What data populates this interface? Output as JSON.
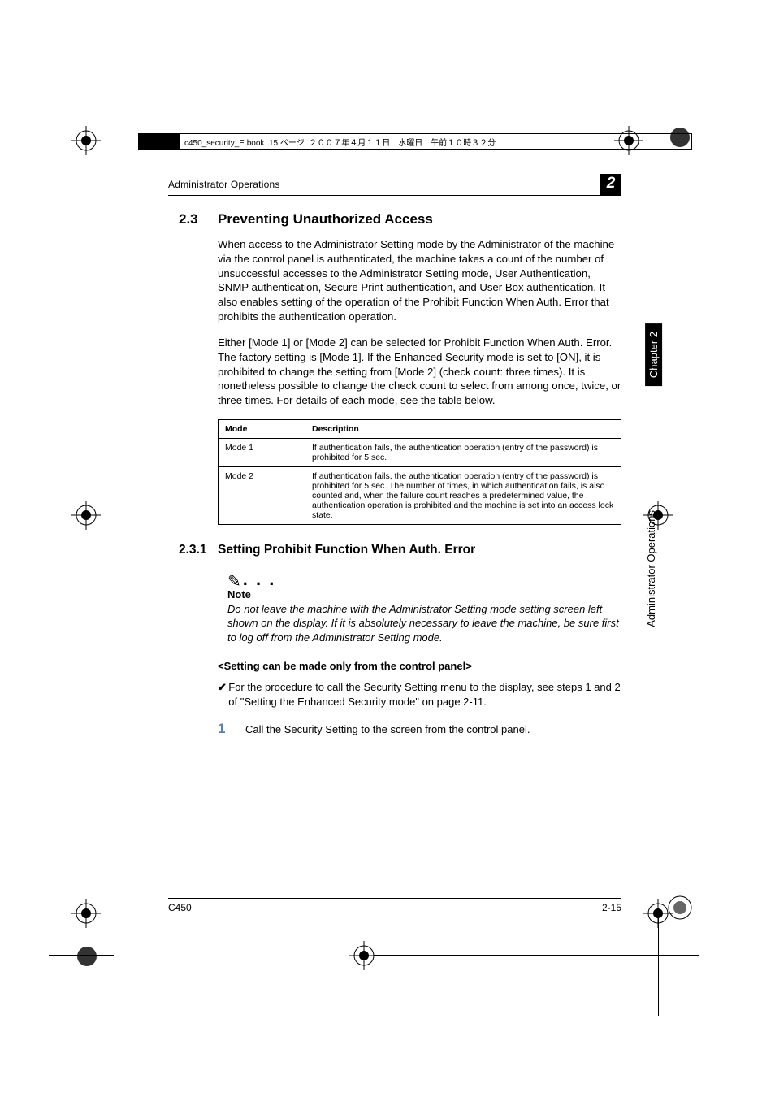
{
  "filebar": "c450_security_E.book  15 ページ  ２００７年４月１１日　水曜日　午前１０時３２分",
  "running_head": "Administrator Operations",
  "chapter_chip": "2",
  "side_chapter": "Chapter 2",
  "side_ops": "Administrator Operations",
  "h2_num": "2.3",
  "h2_title": "Preventing Unauthorized Access",
  "p1": "When access to the Administrator Setting mode by the Administrator of the machine via the control panel is authenticated, the machine takes a count of the number of unsuccessful accesses to the Administrator Setting mode, User Authentication, SNMP authentication, Secure Print authentication, and User Box authentication. It also enables setting of the operation of the Prohibit Function When Auth. Error that prohibits the authentication operation.",
  "p2": "Either [Mode 1] or [Mode 2] can be selected for Prohibit Function When Auth. Error. The factory setting is [Mode 1]. If the Enhanced Security mode is set to [ON], it is prohibited to change the setting from [Mode 2] (check count: three times). It is nonetheless possible to change the check count to select from among once, twice, or three times. For details of each mode, see the table below.",
  "table": {
    "h_mode": "Mode",
    "h_desc": "Description",
    "r1_mode": "Mode 1",
    "r1_desc": "If authentication fails, the authentication operation (entry of the password) is prohibited for 5 sec.",
    "r2_mode": "Mode 2",
    "r2_desc": "If authentication fails, the authentication operation (entry of the password) is prohibited for 5 sec. The number of times, in which authentication fails, is also counted and, when the failure count reaches a predetermined value, the authentication operation is prohibited and the machine is set into an access lock state."
  },
  "h3_num": "2.3.1",
  "h3_title": "Setting Prohibit Function When Auth. Error",
  "note_label": "Note",
  "note_text": "Do not leave the machine with the Administrator Setting mode setting screen left shown on the display. If it is absolutely necessary to leave the machine, be sure first to log off from the Administrator Setting mode.",
  "sub_heading": "<Setting can be made only from the control panel>",
  "check_text": "For the procedure to call the Security Setting menu to the display, see steps 1 and 2 of \"Setting the Enhanced Security mode\" on page 2-11.",
  "step1_num": "1",
  "step1_text": "Call the Security Setting to the screen from the control panel.",
  "footer_model": "C450",
  "footer_page": "2-15"
}
